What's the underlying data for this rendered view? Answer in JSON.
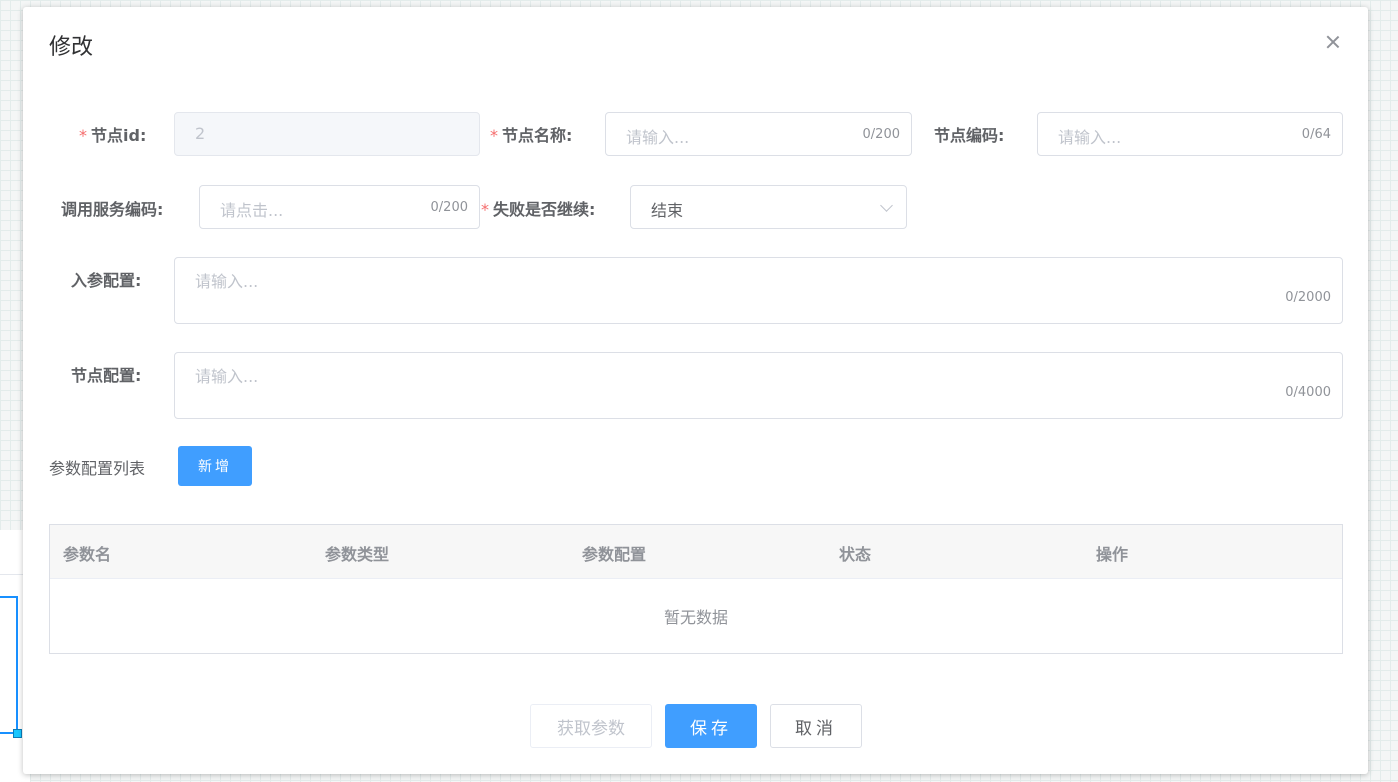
{
  "dialog": {
    "title": "修改"
  },
  "form": {
    "node_id": {
      "label": "节点id:",
      "value": "2",
      "required": true
    },
    "node_name": {
      "label": "节点名称:",
      "placeholder": "请输入...",
      "count": "0/200",
      "required": true
    },
    "node_code": {
      "label": "节点编码:",
      "placeholder": "请输入...",
      "count": "0/64"
    },
    "service_code": {
      "label": "调用服务编码:",
      "placeholder": "请点击...",
      "count": "0/200"
    },
    "continue_on_fail": {
      "label": "失败是否继续:",
      "value": "结束",
      "required": true
    },
    "input_config": {
      "label": "入参配置:",
      "placeholder": "请输入...",
      "count": "0/2000"
    },
    "node_config": {
      "label": "节点配置:",
      "placeholder": "请输入...",
      "count": "0/4000"
    }
  },
  "params": {
    "list_label": "参数配置列表",
    "add_label": "新增",
    "columns": [
      "参数名",
      "参数类型",
      "参数配置",
      "状态",
      "操作"
    ],
    "empty_text": "暂无数据"
  },
  "footer": {
    "fetch_label": "获取参数",
    "save_label": "保存",
    "cancel_label": "取消"
  },
  "colors": {
    "primary": "#409eff",
    "required": "#f56c6c"
  }
}
